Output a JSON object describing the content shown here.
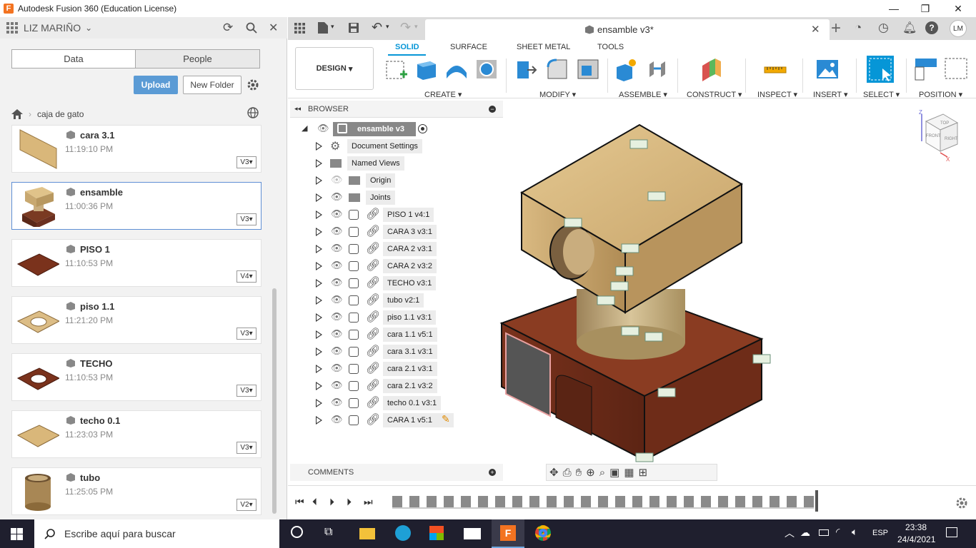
{
  "window": {
    "title": "Autodesk Fusion 360 (Education License)",
    "logo_letter": "F"
  },
  "user": {
    "name": "LIZ MARIÑO"
  },
  "panel_tabs": {
    "data": "Data",
    "people": "People"
  },
  "actions": {
    "upload": "Upload",
    "new_folder": "New Folder"
  },
  "breadcrumb": {
    "folder": "caja de gato"
  },
  "files": [
    {
      "name": "cara 3.1",
      "time": "11:19:10 PM",
      "version": "V3"
    },
    {
      "name": "ensamble",
      "time": "11:00:36 PM",
      "version": "V3"
    },
    {
      "name": "PISO 1",
      "time": "11:10:53 PM",
      "version": "V4"
    },
    {
      "name": "piso 1.1",
      "time": "11:21:20 PM",
      "version": "V3"
    },
    {
      "name": "TECHO",
      "time": "11:10:53 PM",
      "version": "V3"
    },
    {
      "name": "techo 0.1",
      "time": "11:23:03 PM",
      "version": "V3"
    },
    {
      "name": "tubo",
      "time": "11:25:05 PM",
      "version": "V2"
    }
  ],
  "document": {
    "tab_title": "ensamble v3*"
  },
  "avatar": {
    "initials": "LM"
  },
  "ribbon": {
    "workspace": "DESIGN",
    "tabs": [
      "SOLID",
      "SURFACE",
      "SHEET METAL",
      "TOOLS"
    ],
    "groups": [
      "CREATE",
      "MODIFY",
      "ASSEMBLE",
      "CONSTRUCT",
      "INSPECT",
      "INSERT",
      "SELECT",
      "POSITION"
    ]
  },
  "browser": {
    "title": "BROWSER",
    "root": "ensamble v3",
    "items": [
      "Document Settings",
      "Named Views",
      "Origin",
      "Joints",
      "PISO 1 v4:1",
      "CARA 3 v3:1",
      "CARA 2 v3:1",
      "CARA 2 v3:2",
      "TECHO v3:1",
      "tubo v2:1",
      "piso 1.1 v3:1",
      "cara 1.1 v5:1",
      "cara 3.1 v3:1",
      "cara 2.1 v3:1",
      "cara 2.1 v3:2",
      "techo 0.1 v3:1",
      "CARA 1 v5:1"
    ]
  },
  "comments": {
    "title": "COMMENTS"
  },
  "viewcube": {
    "top": "TOP",
    "front": "FRONT",
    "right": "RIGHT",
    "z": "Z",
    "x": "X"
  },
  "taskbar": {
    "search_placeholder": "Escribe aquí para buscar",
    "lang": "ESP",
    "time": "23:38",
    "date": "24/4/2021"
  },
  "colors": {
    "accent": "#0696d7",
    "upload": "#5b9bd5",
    "taskbar": "#1f1f2e"
  }
}
